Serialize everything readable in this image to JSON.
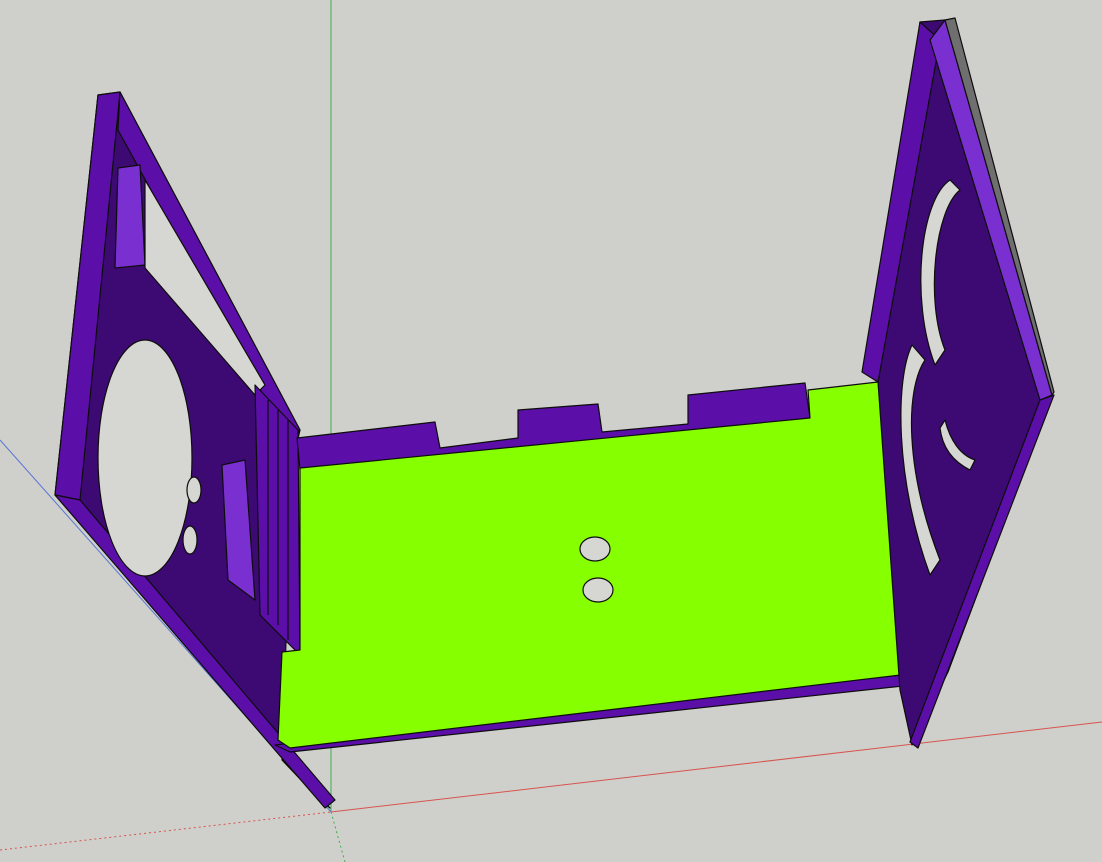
{
  "app": {
    "type": "3D modeling viewport (SketchUp)"
  },
  "viewport": {
    "background": "#cfd0cb",
    "axes": {
      "green": "#3cb04a",
      "red": "#d9534f",
      "blue": "#5a74d6"
    }
  },
  "model": {
    "colors": {
      "panel_purple": "#5b0fa8",
      "panel_purple_dark": "#3c0a72",
      "panel_purple_darker": "#2a0652",
      "panel_purple_light": "#7a2fd0",
      "floor_green": "#86ff00",
      "edge": "#0d0d0d",
      "hole": "#d6d6d3",
      "side_gray": "#6f6f6f"
    }
  }
}
